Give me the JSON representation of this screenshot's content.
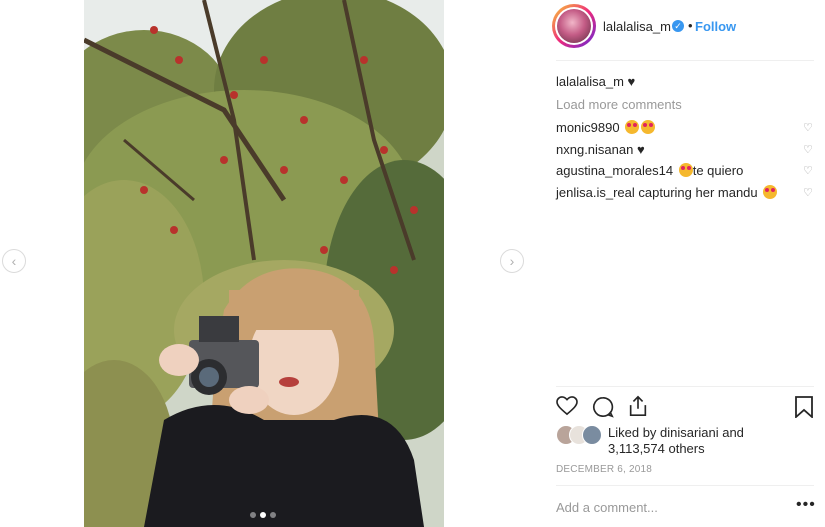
{
  "post": {
    "username": "lalalalisa_m",
    "follow_label": "Follow",
    "separator": "•",
    "caption_user": "lalalalisa_m",
    "caption_text": "♥",
    "load_more": "Load more comments",
    "comments": [
      {
        "user": "monic9890",
        "text": ""
      },
      {
        "user": "nxng.nisanan",
        "text": "♥"
      },
      {
        "user": "agustina_morales14",
        "text": "te quiero"
      },
      {
        "user": "jenlisa.is_real",
        "text": "capturing her mandu"
      }
    ],
    "likes_prefix": "Liked by",
    "likes_user": "dinisariani",
    "likes_and": "and",
    "likes_count": "3,113,574 others",
    "date": "DECEMBER 6, 2018",
    "add_comment_placeholder": "Add a comment...",
    "more_options": "•••"
  },
  "carousel": {
    "slide_count": 3,
    "active_index": 1
  },
  "icons": {
    "left_arrow": "chevron-left-icon",
    "right_arrow": "chevron-right-icon",
    "like": "heart-icon",
    "comment": "comment-icon",
    "share": "share-icon",
    "save": "bookmark-icon",
    "comment_like": "small-heart-icon",
    "verified": "verified-badge-icon"
  },
  "colors": {
    "link_blue": "#3897f0",
    "text": "#262626",
    "muted": "#999999",
    "divider": "#efefef"
  }
}
